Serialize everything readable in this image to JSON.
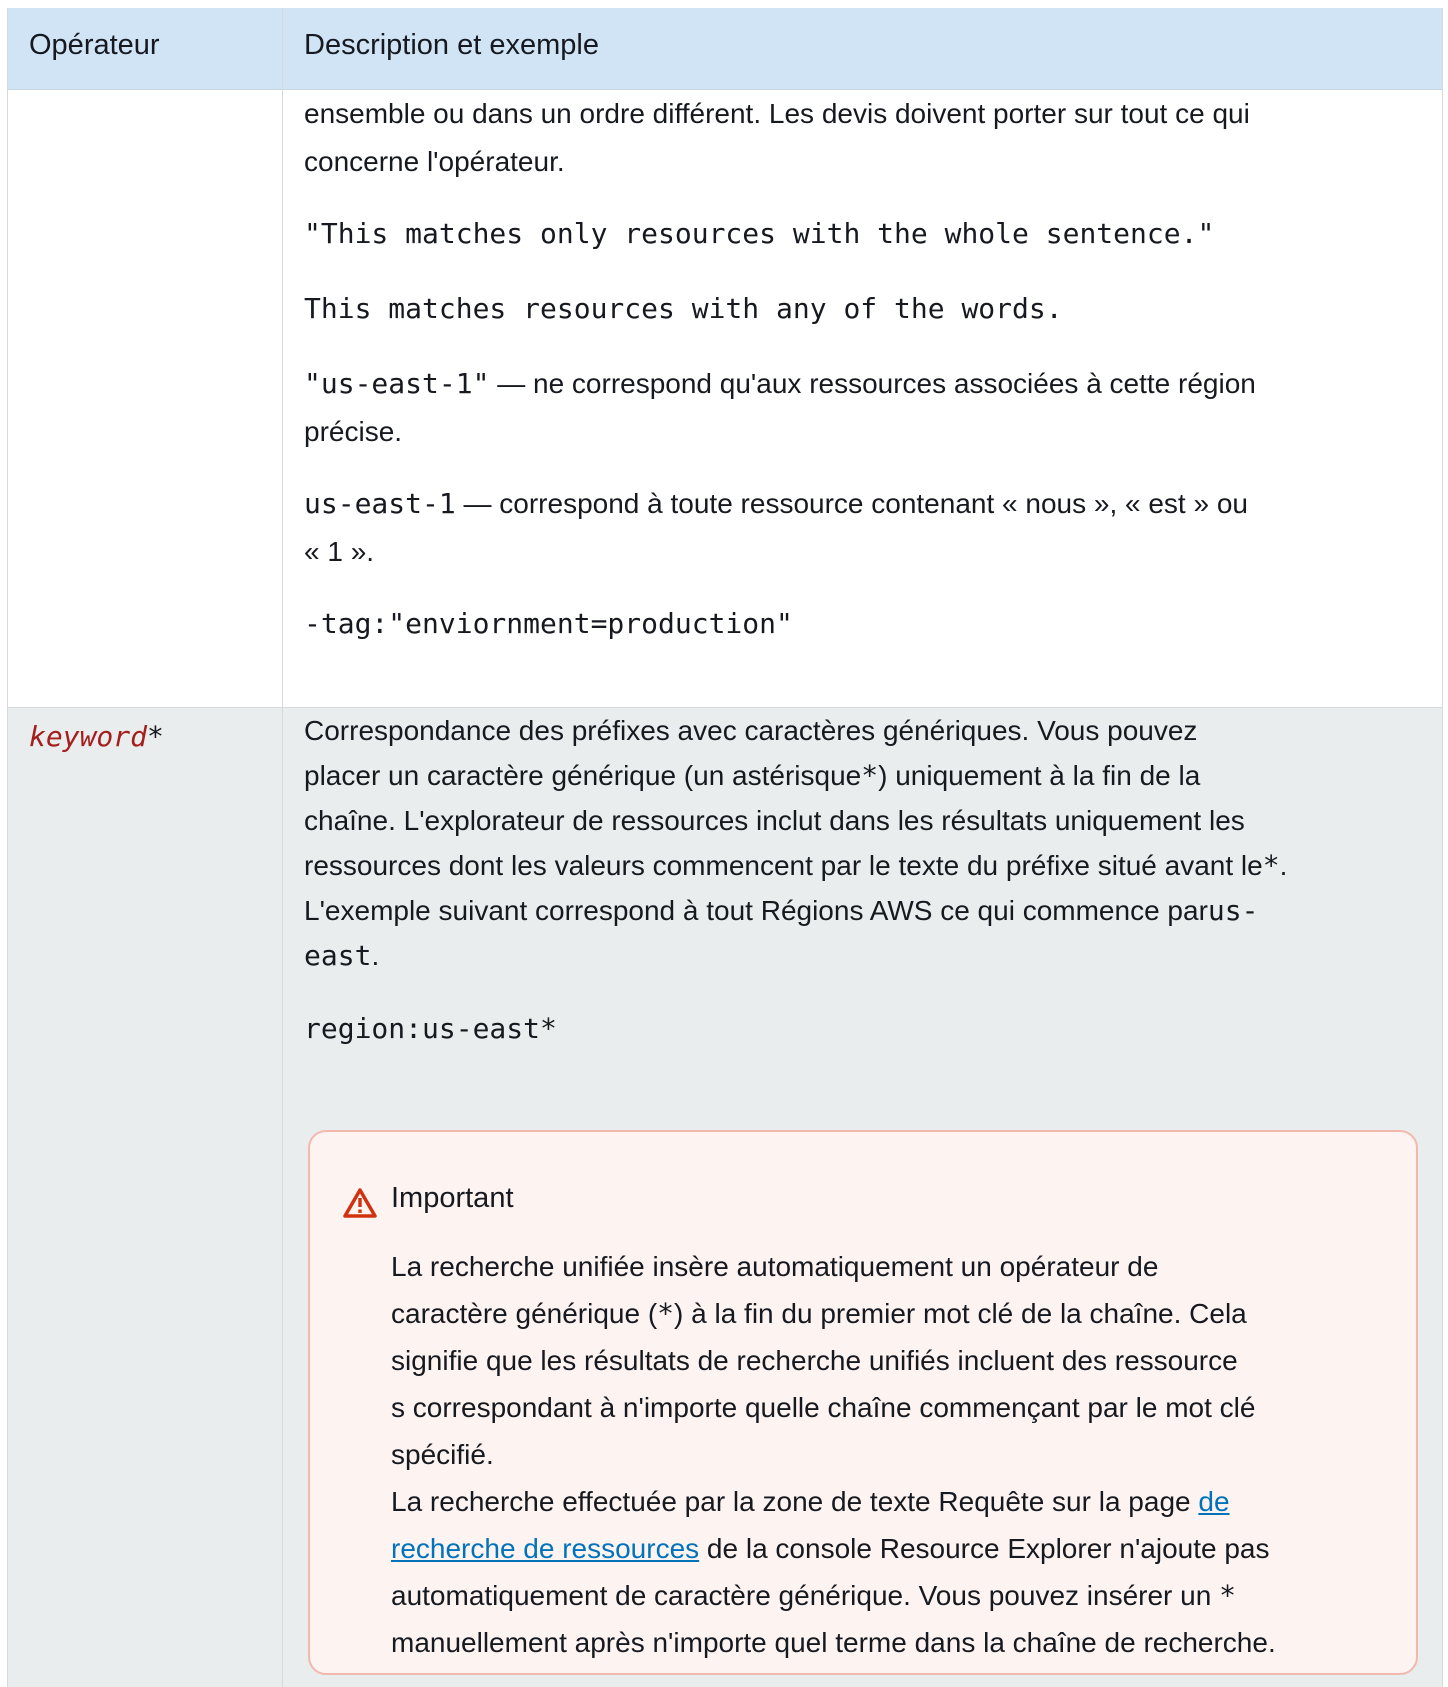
{
  "header": {
    "col_operator": "Opérateur",
    "col_description": "Description et exemple"
  },
  "row_quotes": {
    "desc_line1": "ensemble ou dans un ordre différent. Les devis doivent porter sur tout ce qui",
    "desc_line2": "concerne l'opérateur.",
    "example1": "\"This matches only resources with the whole sentence.\"",
    "example2": "This matches resources with any of the words.",
    "example3_code": "\"us-east-1\"",
    "example3_text_line1": " — ne correspond qu'aux ressources associées à cette région",
    "example3_text_line2": "précise.",
    "example4_code": "us-east-1",
    "example4_text_line1": " — correspond à toute ressource contenant « nous », « est » ou",
    "example4_text_line2": "« 1 ».",
    "example5": "-tag:\"enviornment=production\""
  },
  "row_wildcard": {
    "operator_keyword": "keyword",
    "operator_star": "*",
    "desc_line1": "Correspondance des préfixes avec caractères génériques. Vous pouvez",
    "desc_line2_a": "placer un caractère générique (un astérisque",
    "desc_line2_code": "*",
    "desc_line2_b": ") uniquement à la fin de la",
    "desc_line3": "chaîne. L'explorateur de ressources inclut dans les résultats uniquement les",
    "desc_line4_a": "ressources dont les valeurs commencent par le texte du préfixe situé avant le",
    "desc_line4_code": "*",
    "desc_line4_b": ".",
    "desc_line5_a": "L'exemple suivant correspond à tout Régions AWS ce qui commence par",
    "desc_line5_code": "us-",
    "desc_line6_code": "east",
    "desc_line6_b": ".",
    "example": "region:us-east*"
  },
  "alert": {
    "title": "Important",
    "p1_line1": "La recherche unifiée insère automatiquement un opérateur de",
    "p1_line2_a": "caractère générique (",
    "p1_line2_code": "*",
    "p1_line2_b": ") à la fin du premier mot clé de la chaîne. Cela",
    "p1_line3": "signifie que les résultats de recherche unifiés incluent des ressource",
    "p1_line4": "s correspondant à n'importe quelle chaîne commençant par le mot clé",
    "p1_line5": "spécifié.",
    "p2_line1_a": "La recherche effectuée par la zone de texte Requête sur la page ",
    "p2_link_part1": "de",
    "p2_link_part2": "recherche de ressources",
    "p2_line2_b": " de la console Resource Explorer n'ajoute pas",
    "p2_line3_a": "automatiquement de caractère générique. Vous pouvez insérer un ",
    "p2_line3_code": "*",
    "p2_line4": "manuellement après n'importe quel terme dans la chaîne de recherche."
  },
  "colors": {
    "header_bg": "#d1e4f5",
    "alt_row_bg": "#eaeded",
    "alert_bg": "#fdf3f1",
    "alert_border": "#f2b8ad",
    "warning_icon": "#d13212",
    "keyword_color": "#a51e1e",
    "link_color": "#0073bb"
  },
  "icons": {
    "alert_icon": "warning-triangle-icon"
  }
}
